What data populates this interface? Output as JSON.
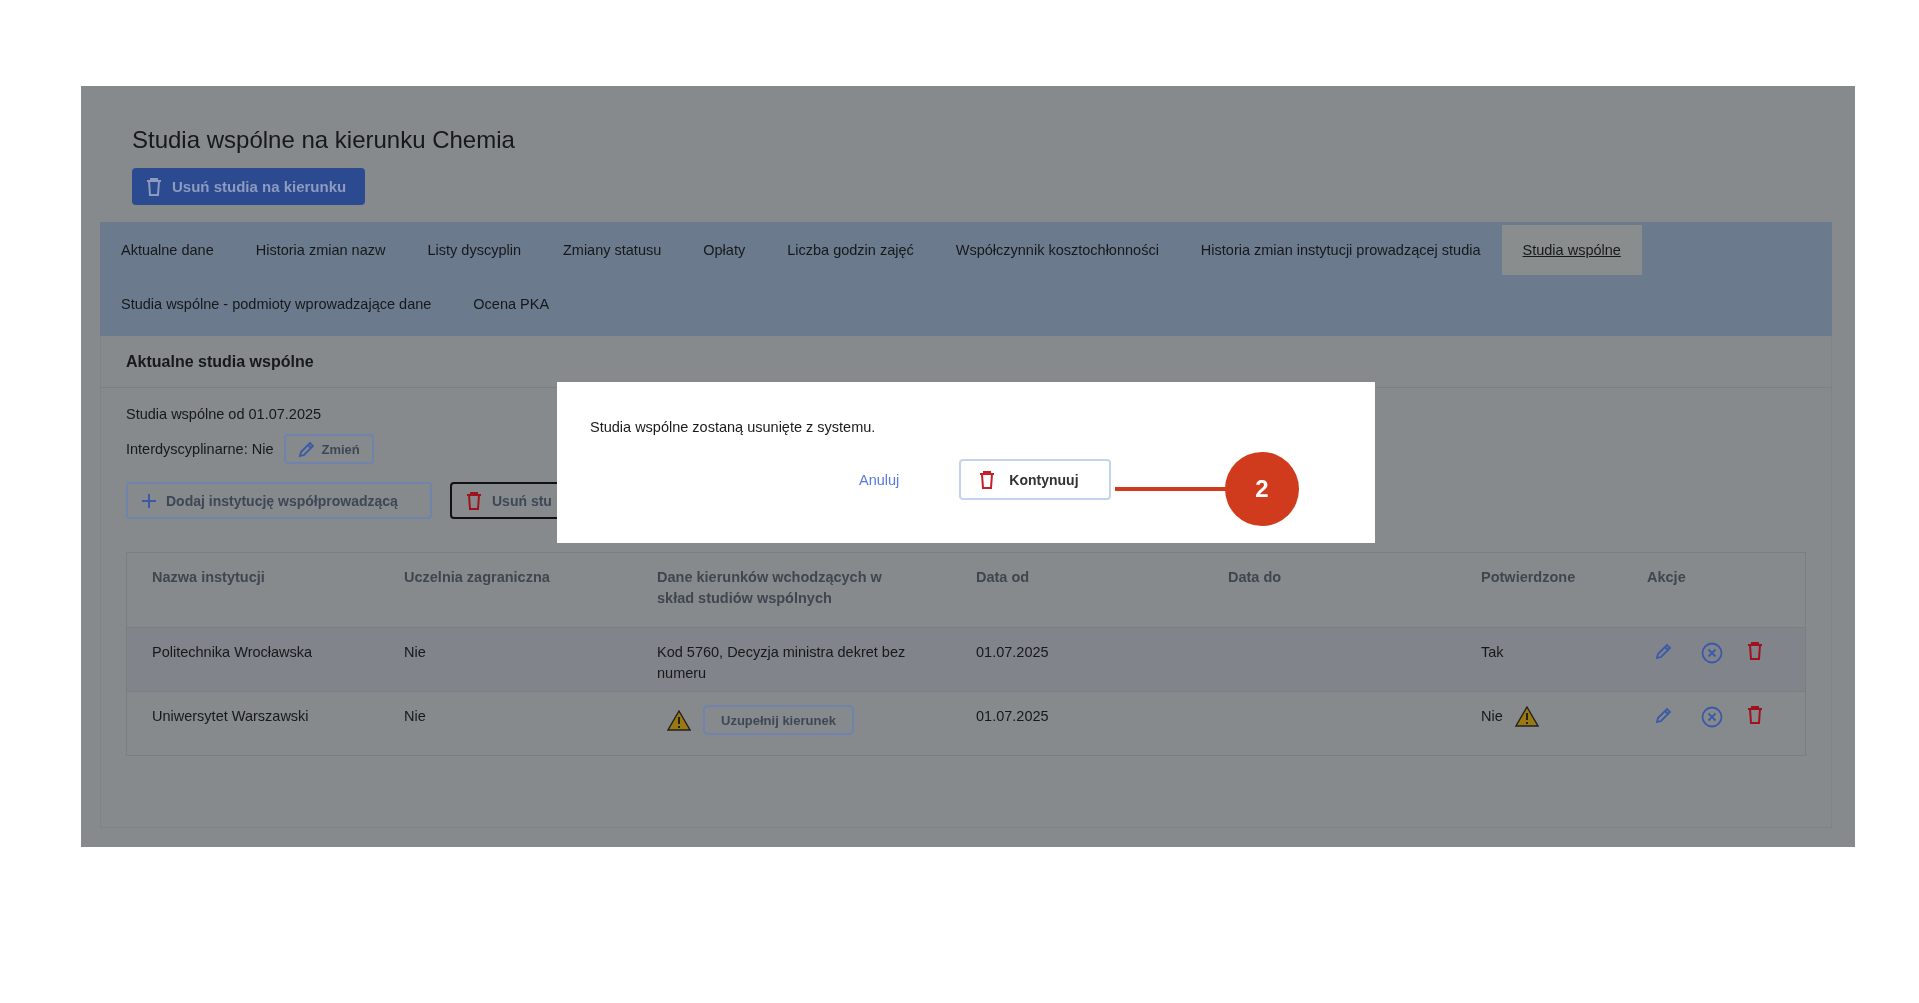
{
  "page": {
    "title": "Studia wspólne na kierunku Chemia",
    "delete_button": "Usuń studia na kierunku"
  },
  "tabs": [
    {
      "label": "Aktualne dane",
      "selected": false
    },
    {
      "label": "Historia zmian nazw",
      "selected": false
    },
    {
      "label": "Listy dyscyplin",
      "selected": false
    },
    {
      "label": "Zmiany statusu",
      "selected": false
    },
    {
      "label": "Opłaty",
      "selected": false
    },
    {
      "label": "Liczba godzin zajęć",
      "selected": false
    },
    {
      "label": "Współczynnik kosztochłonności",
      "selected": false
    },
    {
      "label": "Historia zmian instytucji prowadzącej studia",
      "selected": false
    },
    {
      "label": "Studia wspólne",
      "selected": true
    },
    {
      "label": "Studia wspólne - podmioty wprowadzające dane",
      "selected": false
    },
    {
      "label": "Ocena PKA",
      "selected": false
    }
  ],
  "section": {
    "title": "Aktualne studia wspólne",
    "since": "Studia wspólne od 01.07.2025",
    "interdisciplinary": "Interdyscyplinarne: Nie",
    "change_button": "Zmień",
    "add_button": "Dodaj instytucję współprowadzącą",
    "remove_button": "Usuń stu"
  },
  "table": {
    "columns": [
      "Nazwa instytucji",
      "Uczelnia zagraniczna",
      "Dane kierunków wchodzących w skład studiów wspólnych",
      "Data od",
      "Data do",
      "Potwierdzone",
      "Akcje"
    ],
    "rows": [
      {
        "institution": "Politechnika Wrocławska",
        "foreign": "Nie",
        "programs": {
          "kind": "text",
          "text": "Kod 5760, Decyzja ministra dekret bez numeru"
        },
        "date_from": "01.07.2025",
        "confirmed": "Tak",
        "confirmed_warning": false,
        "highlighted": true
      },
      {
        "institution": "Uniwersytet Warszawski",
        "foreign": "Nie",
        "programs": {
          "kind": "missing",
          "button": "Uzupełnij kierunek"
        },
        "date_from": "01.07.2025",
        "confirmed": "Nie",
        "confirmed_warning": true,
        "highlighted": false
      }
    ]
  },
  "dialog": {
    "message": "Studia wspólne zostaną usunięte z systemu.",
    "cancel": "Anuluj",
    "confirm": "Kontynuuj"
  },
  "callout": {
    "number": "2"
  }
}
